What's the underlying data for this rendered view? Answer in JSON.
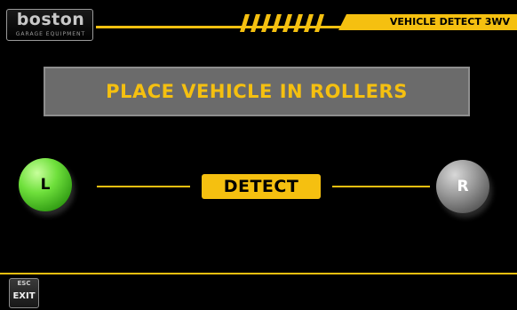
{
  "header": {
    "logo_text": "boston",
    "logo_subtext": "GARAGE EQUIPMENT",
    "title": "VEHICLE DETECT 3WV"
  },
  "banner": {
    "message": "PLACE VEHICLE IN ROLLERS"
  },
  "rollers": {
    "left_label": "L",
    "right_label": "R",
    "left_state": "active",
    "right_state": "inactive"
  },
  "detect": {
    "label": "DETECT"
  },
  "footer": {
    "exit_key": "ESC",
    "exit_label": "EXIT"
  },
  "colors": {
    "accent": "#f5c010",
    "background": "#000000",
    "banner_bg": "#6b6b6b",
    "active_green": "#6fe03c",
    "inactive_grey": "#9a9a9a"
  }
}
